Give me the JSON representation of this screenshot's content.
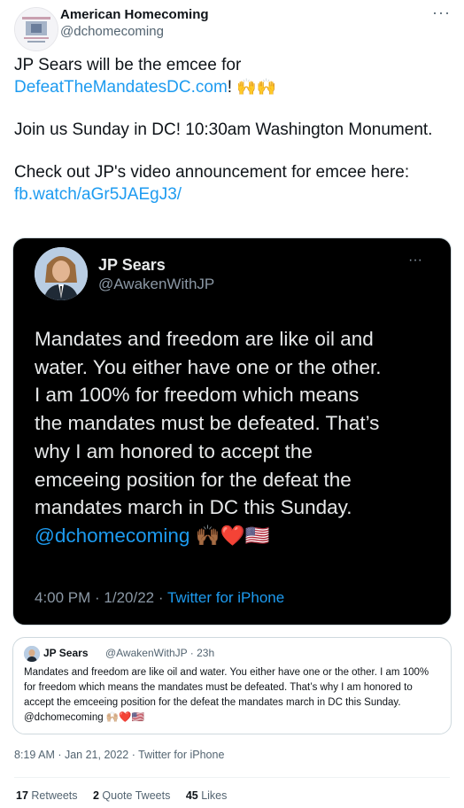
{
  "author": {
    "name": "American Homecoming",
    "handle": "@dchomecoming",
    "more_label": "···"
  },
  "tweet": {
    "line1_prefix": "JP Sears will be the emcee for",
    "link1": "DefeatTheMandatesDC.com",
    "line2_suffix": "!",
    "emoji1": "🙌🙌",
    "para2": "Join us Sunday in DC! 10:30am Washington Monument.",
    "para3": "Check out JP's video announcement for emcee here:",
    "link2": "fb.watch/aGr5JAEgJ3/"
  },
  "image_tweet": {
    "name": "JP Sears",
    "handle": "@AwakenWithJP",
    "more_label": "···",
    "lines": [
      "Mandates and freedom are like oil and",
      "water. You either have one or the other.",
      "I am 100% for freedom which means",
      "the mandates must be defeated. That’s",
      "why I am honored to accept the",
      "emceeing position for the defeat the",
      "mandates march in DC this Sunday."
    ],
    "mention": "@dchomecoming",
    "emoji": "🙌🏾❤️🇺🇸",
    "time_date": "4:00 PM · 1/20/22 · ",
    "source": "Twitter for iPhone"
  },
  "quote": {
    "name": "JP Sears",
    "handle_time": "@AwakenWithJP · 23h",
    "text": "Mandates and freedom are like oil and water. You either have one or the other. I am 100% for freedom which means the mandates must be defeated. That’s why I am honored to accept the emceeing position for the defeat the mandates march in DC this Sunday. @dchomecoming 🙌🏼❤️🇺🇸"
  },
  "meta": "8:19 AM · Jan 21, 2022 · Twitter for iPhone",
  "stats": {
    "retweets_count": "17",
    "retweets_label": "Retweets",
    "quotes_count": "2",
    "quotes_label": "Quote Tweets",
    "likes_count": "45",
    "likes_label": "Likes"
  }
}
